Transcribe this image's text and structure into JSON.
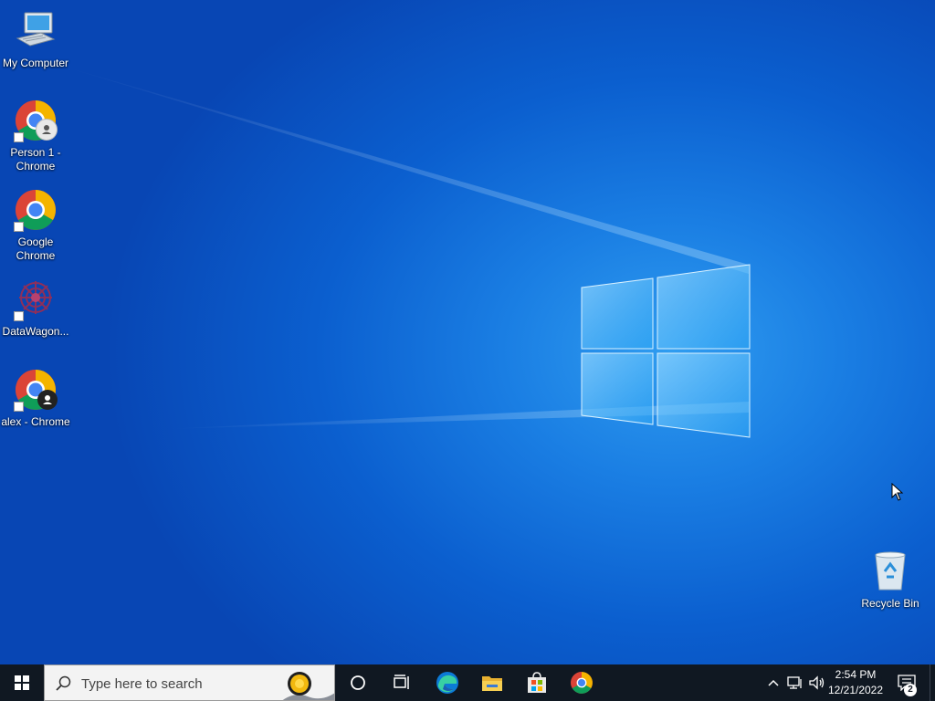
{
  "desktop": {
    "icons": [
      {
        "label": "My Computer"
      },
      {
        "label": "Person 1 - Chrome"
      },
      {
        "label": "Google Chrome"
      },
      {
        "label": "DataWagon..."
      },
      {
        "label": "alex - Chrome"
      },
      {
        "label": "Recycle Bin"
      }
    ]
  },
  "taskbar": {
    "search_placeholder": "Type here to search",
    "pinned_apps": [
      "cortana-icon",
      "task-view-icon",
      "edge-icon",
      "file-explorer-icon",
      "microsoft-store-icon",
      "chrome-icon"
    ],
    "clock": {
      "time": "2:54 PM",
      "date": "12/21/2022"
    },
    "notification_count": "2"
  },
  "colors": {
    "taskbar": "#101822",
    "desktop_accent": "#1a7ee3"
  }
}
